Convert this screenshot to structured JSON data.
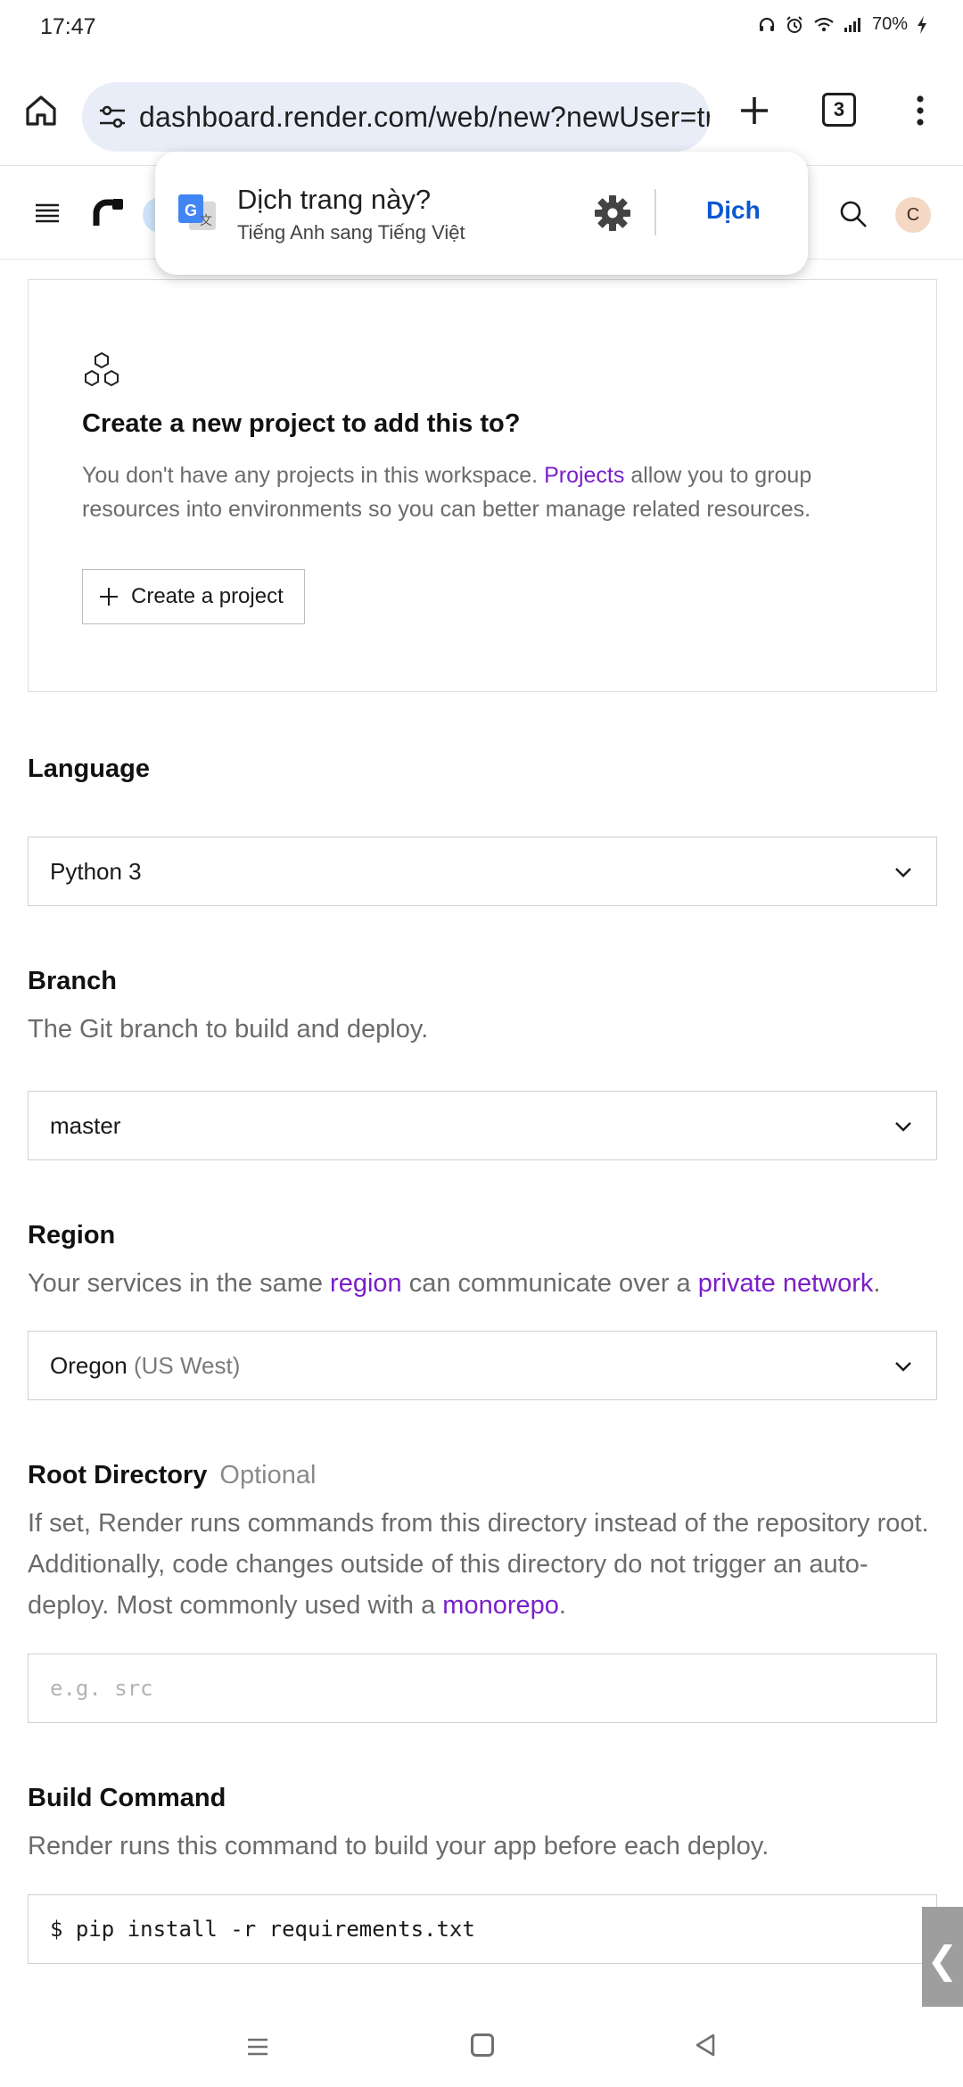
{
  "status_bar": {
    "time": "17:47",
    "battery": "70%"
  },
  "browser": {
    "url": "dashboard.render.com/web/new?newUser=true",
    "tab_count": "3"
  },
  "header": {
    "avatar_initial": "C"
  },
  "translate_popup": {
    "title": "Dịch trang này?",
    "subtitle": "Tiếng Anh sang Tiếng Việt",
    "action": "Dịch"
  },
  "project_card": {
    "title": "Create a new project to add this to?",
    "desc_before": "You don't have any projects in this workspace.",
    "desc_link": "Projects",
    "desc_after": "allow you to group resources into environments so you can better manage related resources.",
    "button_label": "Create a project"
  },
  "language": {
    "label": "Language",
    "value": "Python 3"
  },
  "branch": {
    "label": "Branch",
    "help": "The Git branch to build and deploy.",
    "value": "master"
  },
  "region": {
    "label": "Region",
    "help_1": "Your services in the same",
    "help_link_1": "region",
    "help_2": "can communicate over a",
    "help_link_2": "private network",
    "help_3": ".",
    "value_main": "Oregon",
    "value_sub": "(US West)"
  },
  "root_directory": {
    "label": "Root Directory",
    "optional": "Optional",
    "help": "If set, Render runs commands from this directory instead of the repository root. Additionally, code changes outside of this directory do not trigger an auto-deploy. Most commonly used with a",
    "help_link": "monorepo",
    "help_end": ".",
    "placeholder": "e.g. src"
  },
  "build_command": {
    "label": "Build Command",
    "help": "Render runs this command to build your app before each deploy.",
    "value": "$ pip install -r requirements.txt"
  },
  "side_handle": {
    "glyph": "❮"
  }
}
